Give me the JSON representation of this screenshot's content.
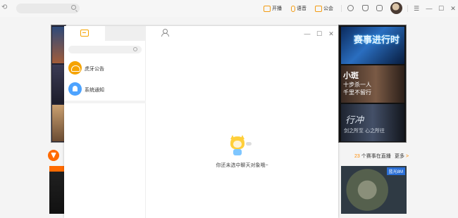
{
  "topbar": {
    "start_live_label": "开播",
    "voice_label": "语音",
    "guild_label": "公会"
  },
  "background": {
    "banner1_text": "赛事进行时",
    "banner2_line1": "小斑",
    "banner2_line2": "十步杀一人",
    "banner2_line3": "千里不留行",
    "banner3_text": "行冲",
    "banner3_sub": "剑之所至 心之所往",
    "live_count_number": "23",
    "live_count_suffix": " 个赛事在直播",
    "more_label": "更多",
    "more_arrow": ">",
    "right_game_badge": "蓝光8M"
  },
  "chat": {
    "conversations": [
      {
        "name": "虎牙公告",
        "icon": "huya-announcement-icon"
      },
      {
        "name": "系统通知",
        "icon": "bell-icon"
      }
    ],
    "empty_message": "你还未选中聊天对象哦~"
  },
  "colors": {
    "accent": "#f5a300",
    "brand_orange": "#ff6a00",
    "system_blue": "#4da3ff"
  }
}
